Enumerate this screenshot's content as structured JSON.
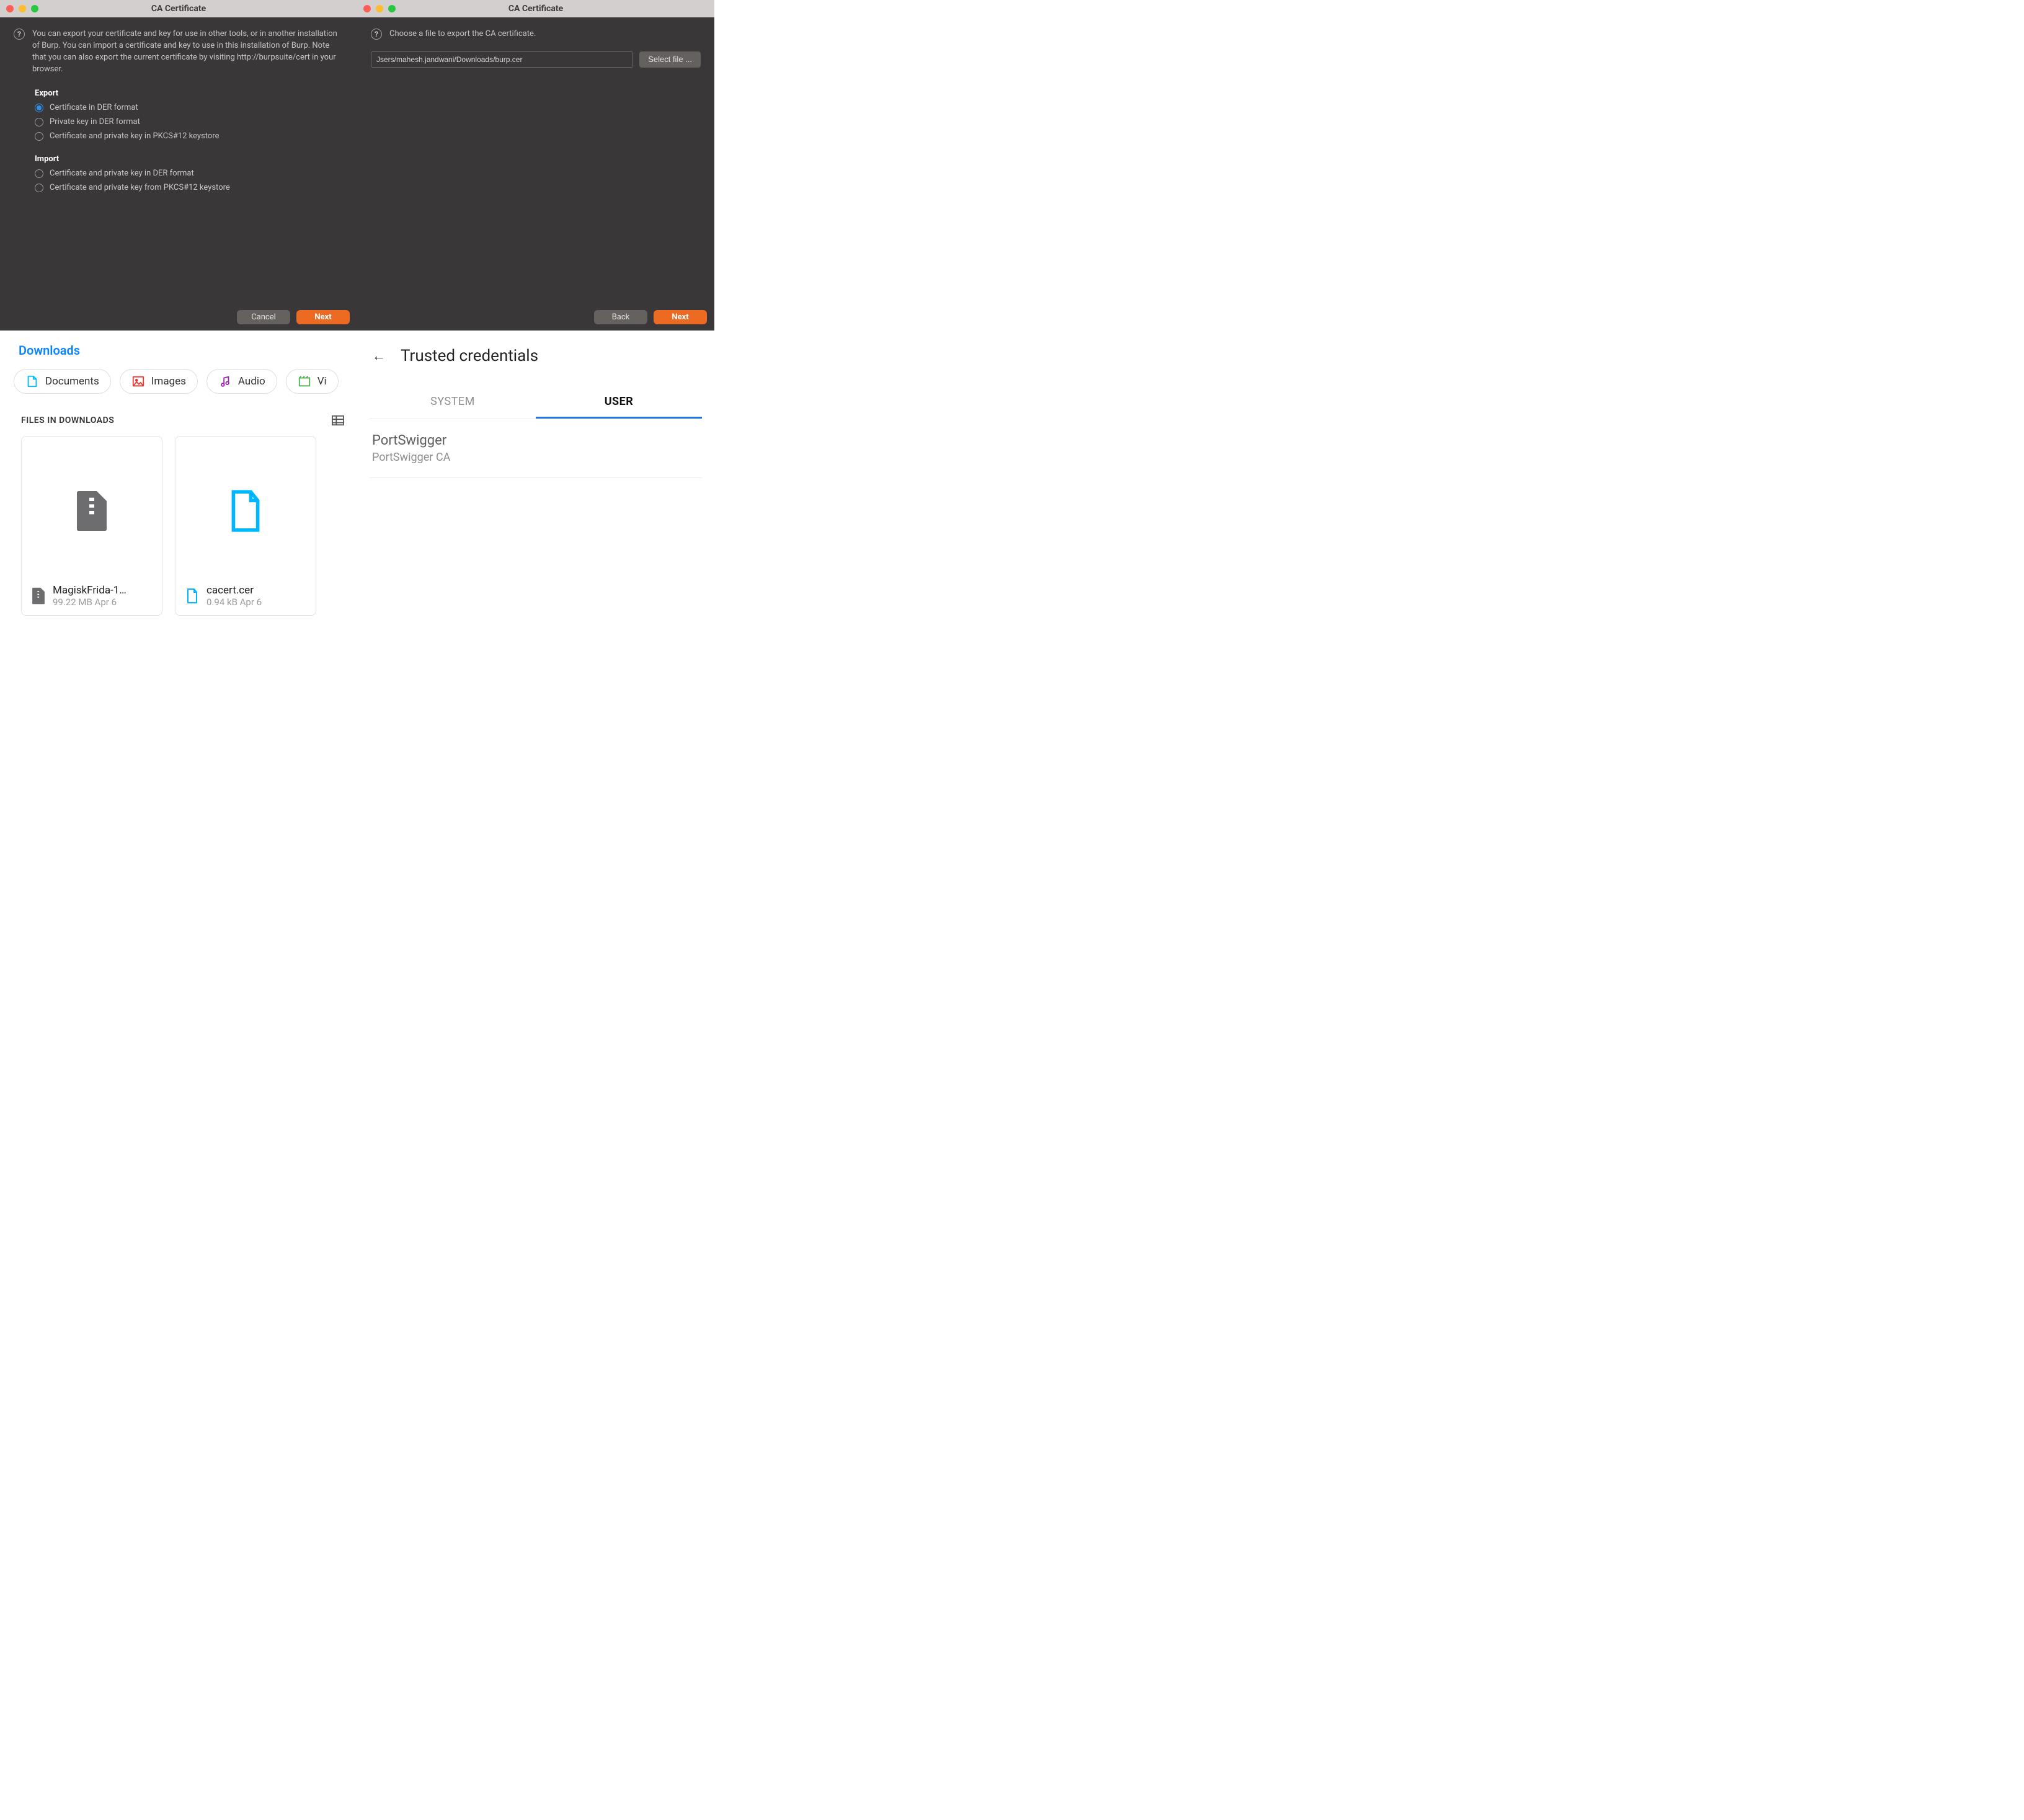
{
  "burp1": {
    "title": "CA Certificate",
    "intro": "You can export your certificate and key for use in other tools, or in another installation of Burp. You can import a certificate and key to use in this installation of Burp. Note that you can also export the current certificate by visiting http://burpsuite/cert in your browser.",
    "export_h": "Export",
    "import_h": "Import",
    "opts": {
      "e1": "Certificate in DER format",
      "e2": "Private key in DER format",
      "e3": "Certificate and private key in PKCS#12 keystore",
      "i1": "Certificate and private key in DER format",
      "i2": "Certificate and private key from PKCS#12 keystore"
    },
    "cancel": "Cancel",
    "next": "Next"
  },
  "burp2": {
    "title": "CA Certificate",
    "intro": "Choose a file to export the CA certificate.",
    "path": "Jsers/mahesh.jandwani/Downloads/burp.cer",
    "select": "Select file ...",
    "back": "Back",
    "next": "Next"
  },
  "downloads": {
    "title": "Downloads",
    "chips": {
      "docs": "Documents",
      "images": "Images",
      "audio": "Audio",
      "video": "Vi"
    },
    "section": "FILES IN DOWNLOADS",
    "files": [
      {
        "name": "MagiskFrida-1…",
        "meta": "99.22 MB Apr 6"
      },
      {
        "name": "cacert.cer",
        "meta": "0.94 kB Apr 6"
      }
    ]
  },
  "tc": {
    "title": "Trusted credentials",
    "tab_system": "SYSTEM",
    "tab_user": "USER",
    "cred_name": "PortSwigger",
    "cred_sub": "PortSwigger CA"
  }
}
